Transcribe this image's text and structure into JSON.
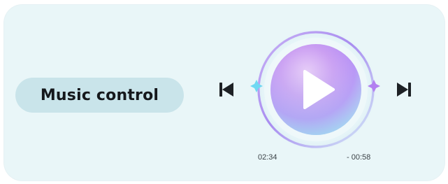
{
  "widget": {
    "label": "Music control",
    "elapsed": "02:34",
    "remaining": "- 00:58",
    "state": "paused"
  },
  "icons": {
    "previous": "skip-previous-icon",
    "play": "play-icon",
    "next": "skip-next-icon",
    "sparkle": "sparkle-icon"
  },
  "colors": {
    "card_background": "#e9f6f8",
    "pill_background": "#c9e4ea",
    "disc_purple": "#b48df5",
    "disc_teal": "#9be6f0",
    "accent_cyan": "#6fd8f2",
    "accent_violet": "#b27ff0",
    "icon_dark": "#1d2125"
  }
}
